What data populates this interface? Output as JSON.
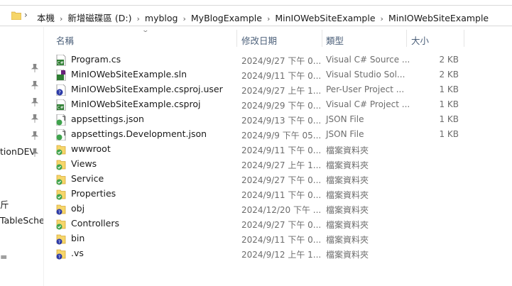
{
  "address_bar": {
    "crumbs": [
      "本機",
      "新增磁碟區 (D:)",
      "myblog",
      "MyBlogExample",
      "MinIOWebSiteExample",
      "MinIOWebSiteExample"
    ]
  },
  "nav_pane": {
    "partial_labels": [
      "tionDEV",
      "斤",
      "TableSche",
      "="
    ]
  },
  "columns": {
    "name": "名稱",
    "modified": "修改日期",
    "type": "類型",
    "size": "大小"
  },
  "files": [
    {
      "name": "Program.cs",
      "modified": "2024/9/27 下午 0...",
      "type": "Visual C# Source ...",
      "size": "2 KB",
      "icon": "csharp-file-icon"
    },
    {
      "name": "MinIOWebSiteExample.sln",
      "modified": "2024/9/11 下午 0...",
      "type": "Visual Studio Sol...",
      "size": "2 KB",
      "icon": "solution-file-icon"
    },
    {
      "name": "MinIOWebSiteExample.csproj.user",
      "modified": "2024/9/27 上午 1...",
      "type": "Per-User Project ...",
      "size": "1 KB",
      "icon": "project-user-file-icon"
    },
    {
      "name": "MinIOWebSiteExample.csproj",
      "modified": "2024/9/29 下午 0...",
      "type": "Visual C# Project ...",
      "size": "1 KB",
      "icon": "csproj-file-icon"
    },
    {
      "name": "appsettings.json",
      "modified": "2024/9/13 下午 0...",
      "type": "JSON File",
      "size": "1 KB",
      "icon": "json-file-icon"
    },
    {
      "name": "appsettings.Development.json",
      "modified": "2024/9/9 下午 05...",
      "type": "JSON File",
      "size": "1 KB",
      "icon": "json-file-icon"
    },
    {
      "name": "wwwroot",
      "modified": "2024/9/11 下午 0...",
      "type": "檔案資料夾",
      "size": "",
      "icon": "folder-synced-icon"
    },
    {
      "name": "Views",
      "modified": "2024/9/27 上午 1...",
      "type": "檔案資料夾",
      "size": "",
      "icon": "folder-synced-icon"
    },
    {
      "name": "Service",
      "modified": "2024/9/27 下午 0...",
      "type": "檔案資料夾",
      "size": "",
      "icon": "folder-synced-icon"
    },
    {
      "name": "Properties",
      "modified": "2024/9/11 下午 0...",
      "type": "檔案資料夾",
      "size": "",
      "icon": "folder-synced-icon"
    },
    {
      "name": "obj",
      "modified": "2024/12/20 下午 ...",
      "type": "檔案資料夾",
      "size": "",
      "icon": "folder-ignored-icon"
    },
    {
      "name": "Controllers",
      "modified": "2024/9/27 下午 0...",
      "type": "檔案資料夾",
      "size": "",
      "icon": "folder-synced-icon"
    },
    {
      "name": "bin",
      "modified": "2024/9/11 下午 0...",
      "type": "檔案資料夾",
      "size": "",
      "icon": "folder-ignored-icon"
    },
    {
      "name": ".vs",
      "modified": "2024/9/12 上午 1...",
      "type": "檔案資料夾",
      "size": "",
      "icon": "folder-ignored-icon"
    }
  ],
  "colors": {
    "folder": "#f6d66a",
    "synced_badge": "#3fa34d",
    "ignored_badge": "#2b3aa8",
    "header_text": "#4c607a"
  }
}
